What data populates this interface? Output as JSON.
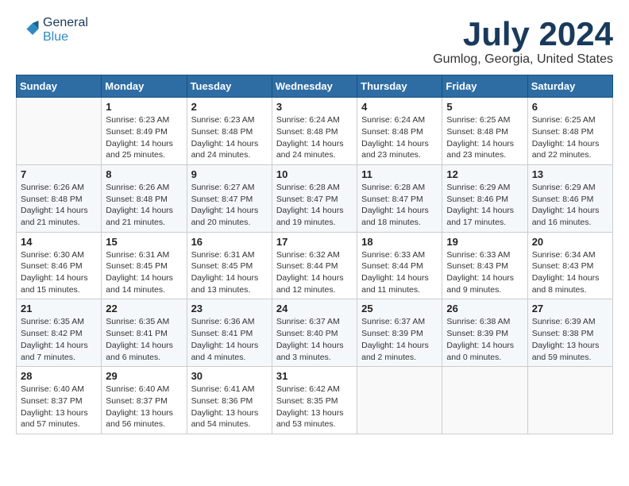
{
  "header": {
    "logo_general": "General",
    "logo_blue": "Blue",
    "month_title": "July 2024",
    "location": "Gumlog, Georgia, United States"
  },
  "weekdays": [
    "Sunday",
    "Monday",
    "Tuesday",
    "Wednesday",
    "Thursday",
    "Friday",
    "Saturday"
  ],
  "weeks": [
    [
      {
        "day": "",
        "info": ""
      },
      {
        "day": "1",
        "info": "Sunrise: 6:23 AM\nSunset: 8:49 PM\nDaylight: 14 hours\nand 25 minutes."
      },
      {
        "day": "2",
        "info": "Sunrise: 6:23 AM\nSunset: 8:48 PM\nDaylight: 14 hours\nand 24 minutes."
      },
      {
        "day": "3",
        "info": "Sunrise: 6:24 AM\nSunset: 8:48 PM\nDaylight: 14 hours\nand 24 minutes."
      },
      {
        "day": "4",
        "info": "Sunrise: 6:24 AM\nSunset: 8:48 PM\nDaylight: 14 hours\nand 23 minutes."
      },
      {
        "day": "5",
        "info": "Sunrise: 6:25 AM\nSunset: 8:48 PM\nDaylight: 14 hours\nand 23 minutes."
      },
      {
        "day": "6",
        "info": "Sunrise: 6:25 AM\nSunset: 8:48 PM\nDaylight: 14 hours\nand 22 minutes."
      }
    ],
    [
      {
        "day": "7",
        "info": "Sunrise: 6:26 AM\nSunset: 8:48 PM\nDaylight: 14 hours\nand 21 minutes."
      },
      {
        "day": "8",
        "info": "Sunrise: 6:26 AM\nSunset: 8:48 PM\nDaylight: 14 hours\nand 21 minutes."
      },
      {
        "day": "9",
        "info": "Sunrise: 6:27 AM\nSunset: 8:47 PM\nDaylight: 14 hours\nand 20 minutes."
      },
      {
        "day": "10",
        "info": "Sunrise: 6:28 AM\nSunset: 8:47 PM\nDaylight: 14 hours\nand 19 minutes."
      },
      {
        "day": "11",
        "info": "Sunrise: 6:28 AM\nSunset: 8:47 PM\nDaylight: 14 hours\nand 18 minutes."
      },
      {
        "day": "12",
        "info": "Sunrise: 6:29 AM\nSunset: 8:46 PM\nDaylight: 14 hours\nand 17 minutes."
      },
      {
        "day": "13",
        "info": "Sunrise: 6:29 AM\nSunset: 8:46 PM\nDaylight: 14 hours\nand 16 minutes."
      }
    ],
    [
      {
        "day": "14",
        "info": "Sunrise: 6:30 AM\nSunset: 8:46 PM\nDaylight: 14 hours\nand 15 minutes."
      },
      {
        "day": "15",
        "info": "Sunrise: 6:31 AM\nSunset: 8:45 PM\nDaylight: 14 hours\nand 14 minutes."
      },
      {
        "day": "16",
        "info": "Sunrise: 6:31 AM\nSunset: 8:45 PM\nDaylight: 14 hours\nand 13 minutes."
      },
      {
        "day": "17",
        "info": "Sunrise: 6:32 AM\nSunset: 8:44 PM\nDaylight: 14 hours\nand 12 minutes."
      },
      {
        "day": "18",
        "info": "Sunrise: 6:33 AM\nSunset: 8:44 PM\nDaylight: 14 hours\nand 11 minutes."
      },
      {
        "day": "19",
        "info": "Sunrise: 6:33 AM\nSunset: 8:43 PM\nDaylight: 14 hours\nand 9 minutes."
      },
      {
        "day": "20",
        "info": "Sunrise: 6:34 AM\nSunset: 8:43 PM\nDaylight: 14 hours\nand 8 minutes."
      }
    ],
    [
      {
        "day": "21",
        "info": "Sunrise: 6:35 AM\nSunset: 8:42 PM\nDaylight: 14 hours\nand 7 minutes."
      },
      {
        "day": "22",
        "info": "Sunrise: 6:35 AM\nSunset: 8:41 PM\nDaylight: 14 hours\nand 6 minutes."
      },
      {
        "day": "23",
        "info": "Sunrise: 6:36 AM\nSunset: 8:41 PM\nDaylight: 14 hours\nand 4 minutes."
      },
      {
        "day": "24",
        "info": "Sunrise: 6:37 AM\nSunset: 8:40 PM\nDaylight: 14 hours\nand 3 minutes."
      },
      {
        "day": "25",
        "info": "Sunrise: 6:37 AM\nSunset: 8:39 PM\nDaylight: 14 hours\nand 2 minutes."
      },
      {
        "day": "26",
        "info": "Sunrise: 6:38 AM\nSunset: 8:39 PM\nDaylight: 14 hours\nand 0 minutes."
      },
      {
        "day": "27",
        "info": "Sunrise: 6:39 AM\nSunset: 8:38 PM\nDaylight: 13 hours\nand 59 minutes."
      }
    ],
    [
      {
        "day": "28",
        "info": "Sunrise: 6:40 AM\nSunset: 8:37 PM\nDaylight: 13 hours\nand 57 minutes."
      },
      {
        "day": "29",
        "info": "Sunrise: 6:40 AM\nSunset: 8:37 PM\nDaylight: 13 hours\nand 56 minutes."
      },
      {
        "day": "30",
        "info": "Sunrise: 6:41 AM\nSunset: 8:36 PM\nDaylight: 13 hours\nand 54 minutes."
      },
      {
        "day": "31",
        "info": "Sunrise: 6:42 AM\nSunset: 8:35 PM\nDaylight: 13 hours\nand 53 minutes."
      },
      {
        "day": "",
        "info": ""
      },
      {
        "day": "",
        "info": ""
      },
      {
        "day": "",
        "info": ""
      }
    ]
  ]
}
